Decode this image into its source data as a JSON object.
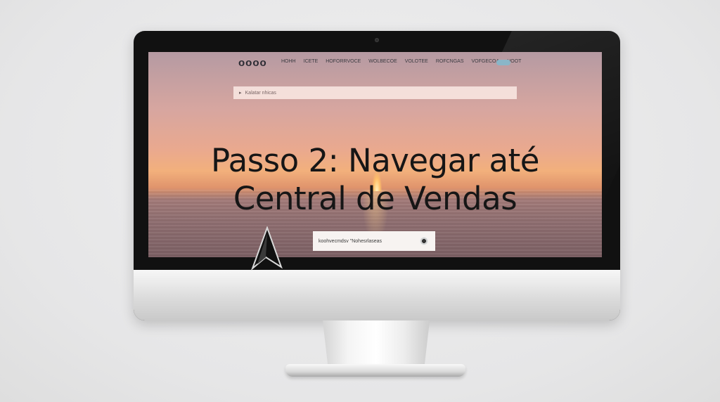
{
  "site": {
    "logo": "oooo",
    "nav_items": [
      "HOHH",
      "ICETE",
      "HOFORRVOCE",
      "WOLBECOE",
      "VOLOTEE",
      "ROFCNGAS",
      "VOFGECOA",
      "HOOT"
    ]
  },
  "search": {
    "icon": "search-icon",
    "placeholder": "Kalatar nhicas"
  },
  "headline": {
    "line1": "Passo 2: Navegar até",
    "line2": "Central de Vendas"
  },
  "cta_box": {
    "text": "koohvecmdsv \"Nohesrlaseas",
    "icon": "disc-icon"
  },
  "colors": {
    "sky_top": "#b59aa2",
    "sunset_glow": "#f2b07c",
    "sea": "#8f6e70",
    "text": "#161616"
  }
}
